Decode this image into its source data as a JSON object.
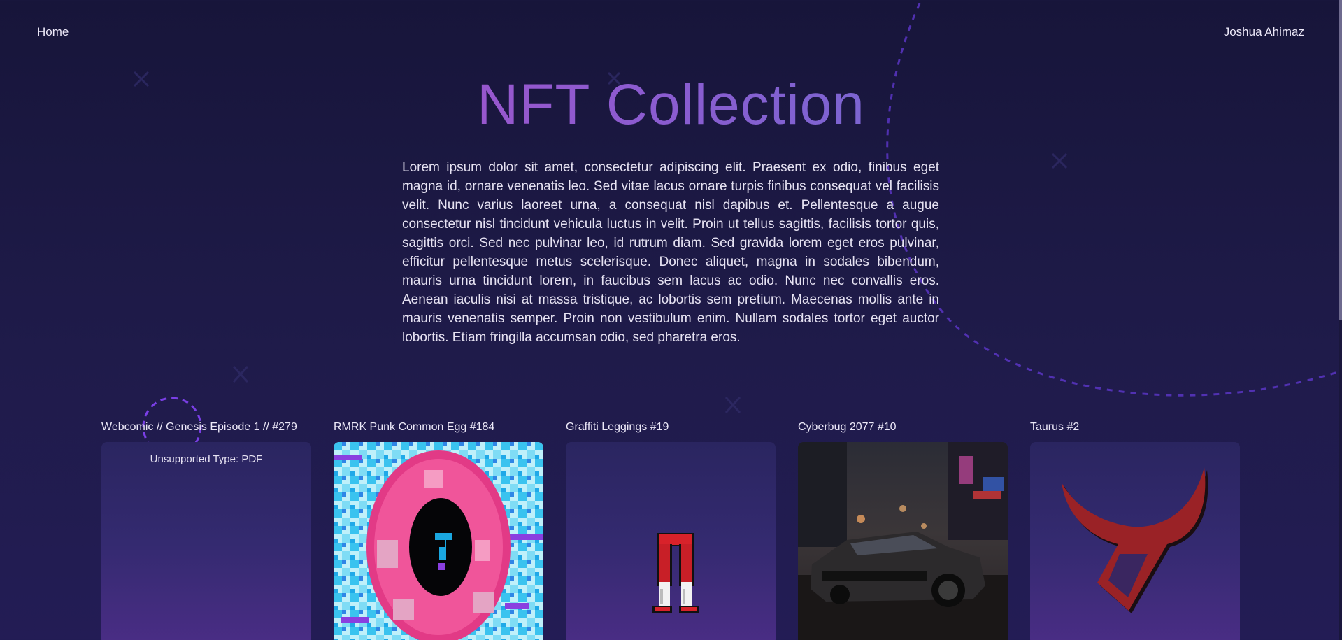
{
  "nav": {
    "home_label": "Home",
    "user_name": "Joshua Ahimaz"
  },
  "hero": {
    "title": "NFT Collection",
    "description": "Lorem ipsum dolor sit amet, consectetur adipiscing elit. Praesent ex odio, finibus eget magna id, ornare venenatis leo. Sed vitae lacus ornare turpis finibus consequat vel facilisis velit. Nunc varius laoreet urna, a consequat nisl dapibus et. Pellentesque a augue consectetur nisl tincidunt vehicula luctus in velit. Proin ut tellus sagittis, facilisis tortor quis, sagittis orci. Sed nec pulvinar leo, id rutrum diam. Sed gravida lorem eget eros pulvinar, efficitur pellentesque metus scelerisque. Donec aliquet, magna in sodales bibendum, mauris urna tincidunt lorem, in faucibus sem lacus ac odio. Nunc nec convallis eros. Aenean iaculis nisi at massa tristique, ac lobortis sem pretium. Maecenas mollis ante in mauris venenatis semper. Proin non vestibulum enim. Nullam sodales tortor eget auctor lobortis. Etiam fringilla accumsan odio, sed pharetra eros."
  },
  "colors": {
    "title_gradient": [
      "#b84ac6",
      "#8a5cd0",
      "#5a78d4"
    ],
    "accent_dashed": "#6a3fd8",
    "background": "#1b1843"
  },
  "nfts": [
    {
      "title": "Webcomic // Genesis Episode 1 // #279",
      "media_type": "unsupported",
      "unsupported_label": "Unsupported Type: PDF"
    },
    {
      "title": "RMRK Punk Common Egg #184",
      "media_type": "pixel-egg-image"
    },
    {
      "title": "Graffiti Leggings #19",
      "media_type": "pixel-leggings-image"
    },
    {
      "title": "Cyberbug 2077 #10",
      "media_type": "car-night-street-image"
    },
    {
      "title": "Taurus #2",
      "media_type": "taurus-symbol-image"
    }
  ]
}
